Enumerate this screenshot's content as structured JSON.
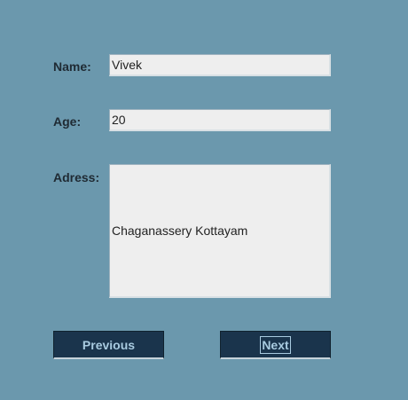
{
  "form": {
    "name_label": "Name:",
    "name_value": "Vivek",
    "age_label": "Age:",
    "age_value": "20",
    "address_label": "Adress:",
    "address_value": "Chaganassery Kottayam"
  },
  "buttons": {
    "previous_label": "Previous",
    "next_label": "Next"
  },
  "colors": {
    "background": "#6b98ad",
    "field_background": "#eeeeee",
    "button_background": "#1a344c",
    "button_text": "#a9cbe0"
  }
}
